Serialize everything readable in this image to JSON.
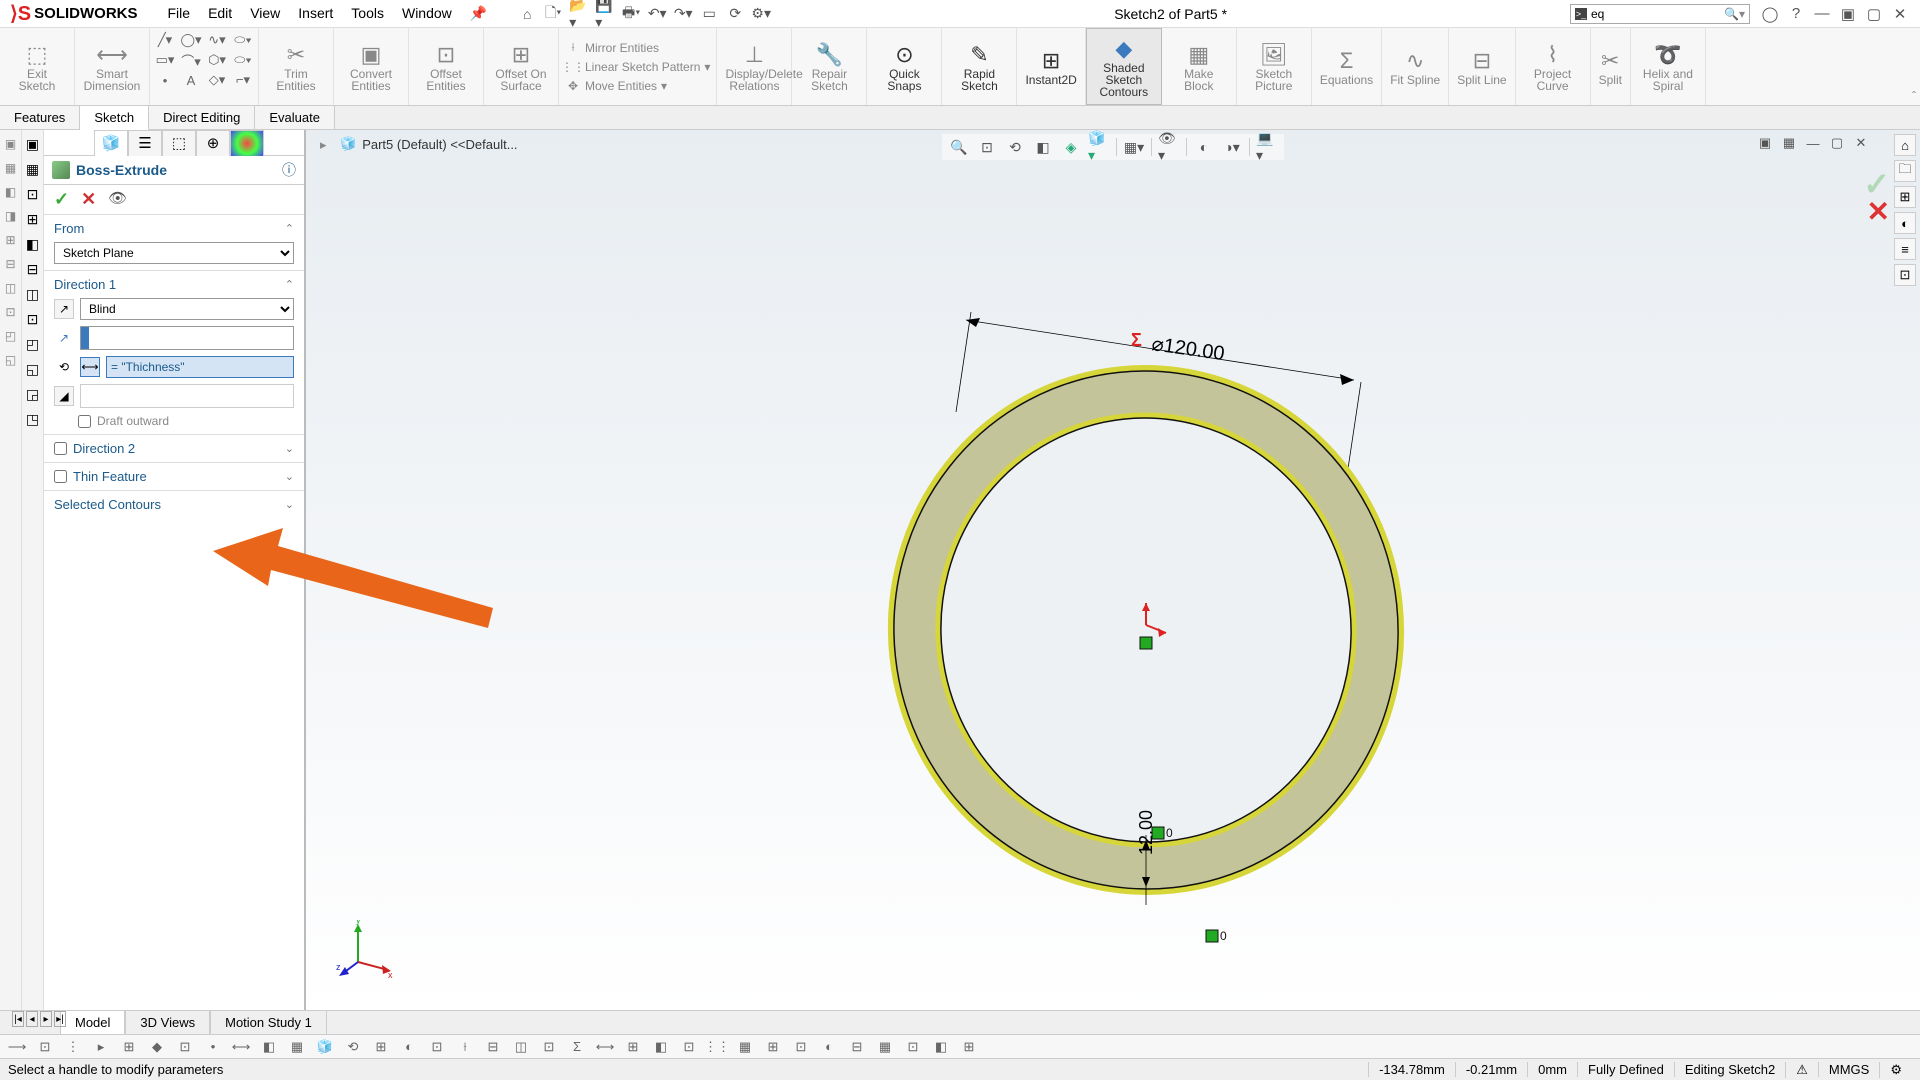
{
  "app": {
    "name": "SOLIDWORKS",
    "doc_title": "Sketch2 of Part5 *"
  },
  "menus": [
    "File",
    "Edit",
    "View",
    "Insert",
    "Tools",
    "Window"
  ],
  "search": {
    "placeholder": "eq"
  },
  "ribbon": {
    "exit_sketch": "Exit Sketch",
    "smart_dimension": "Smart Dimension",
    "trim": "Trim Entities",
    "convert": "Convert Entities",
    "offset": "Offset Entities",
    "offset_surface": "Offset On Surface",
    "mirror": "Mirror Entities",
    "linear_pattern": "Linear Sketch Pattern",
    "move": "Move Entities",
    "display_delete": "Display/Delete Relations",
    "repair": "Repair Sketch",
    "quick_snaps": "Quick Snaps",
    "rapid_sketch": "Rapid Sketch",
    "instant2d": "Instant2D",
    "shaded": "Shaded Sketch Contours",
    "make_block": "Make Block",
    "sketch_picture": "Sketch Picture",
    "equations": "Equations",
    "fit_spline": "Fit Spline",
    "split_line": "Split Line",
    "project_curve": "Project Curve",
    "split": "Split",
    "helix": "Helix and Spiral"
  },
  "tabs": [
    "Features",
    "Sketch",
    "Direct Editing",
    "Evaluate"
  ],
  "tabs_active": 1,
  "breadcrumb": "Part5 (Default) <<Default...",
  "panel": {
    "title": "Boss-Extrude",
    "sections": {
      "from": {
        "label": "From",
        "value": "Sketch Plane"
      },
      "dir1": {
        "label": "Direction 1",
        "end_condition": "Blind",
        "depth_value": "",
        "equation_value": "= \"Thichness\"",
        "draft_outward": "Draft outward"
      },
      "dir2": {
        "label": "Direction 2"
      },
      "thin": {
        "label": "Thin Feature"
      },
      "contours": {
        "label": "Selected Contours"
      }
    }
  },
  "dimensions": {
    "outer_dia": "⌀120.00",
    "wall": "12.00",
    "sigma": "Σ"
  },
  "bottom_tabs": [
    "Model",
    "3D Views",
    "Motion Study 1"
  ],
  "bottom_tabs_active": 0,
  "status": {
    "hint": "Select a handle to modify parameters",
    "x": "-134.78mm",
    "y": "-0.21mm",
    "z": "0mm",
    "state": "Fully Defined",
    "mode": "Editing Sketch2",
    "units": "MMGS"
  }
}
